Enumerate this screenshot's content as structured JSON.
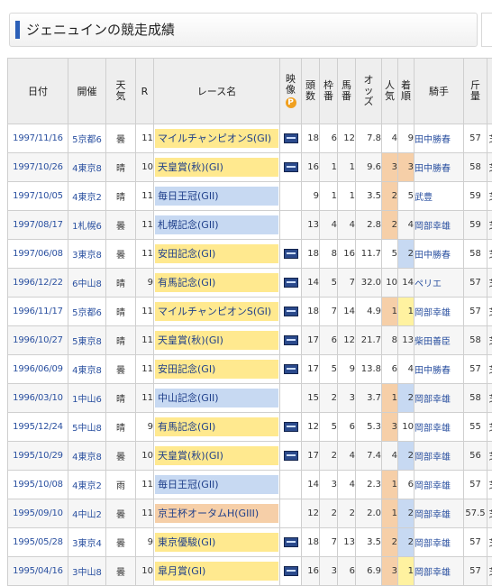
{
  "page": {
    "title": "ジェニュインの競走成績"
  },
  "colors": {
    "accent": "#2b5fb8",
    "g1": "#ffe98f",
    "g2": "#c7d9f2",
    "g3": "#f6cfa8"
  },
  "columns": {
    "date": "日付",
    "course": "開催",
    "weather": "天気",
    "race_no": "R",
    "race_name": "レース名",
    "video": "映像",
    "video_badge": "P",
    "runners": "頭数",
    "gate": "枠番",
    "horse_no": "馬番",
    "odds": "オッズ",
    "popularity": "人気",
    "finish": "着順",
    "jockey": "騎手",
    "weight": "斤量",
    "extra": ""
  },
  "rows": [
    {
      "date": "1997/11/16",
      "course": "5京都6",
      "weather": "曇",
      "race_no": "11",
      "race_name": "マイルチャンピオンS(GI)",
      "grade": "g1",
      "video": true,
      "runners": "18",
      "gate": "6",
      "horse_no": "12",
      "odds": "7.8",
      "popularity": "4",
      "finish": "9",
      "jockey": "田中勝春",
      "weight": "57",
      "extra": "芝"
    },
    {
      "date": "1997/10/26",
      "course": "4東京8",
      "weather": "晴",
      "race_no": "10",
      "race_name": "天皇賞(秋)(GI)",
      "grade": "g1",
      "video": true,
      "runners": "16",
      "gate": "1",
      "horse_no": "1",
      "odds": "9.6",
      "popularity": "3",
      "finish": "3",
      "jockey": "田中勝春",
      "weight": "58",
      "extra": "芝"
    },
    {
      "date": "1997/10/05",
      "course": "4東京2",
      "weather": "晴",
      "race_no": "11",
      "race_name": "毎日王冠(GII)",
      "grade": "g2",
      "video": false,
      "runners": "9",
      "gate": "1",
      "horse_no": "1",
      "odds": "3.5",
      "popularity": "2",
      "finish": "5",
      "jockey": "武豊",
      "weight": "59",
      "extra": "芝"
    },
    {
      "date": "1997/08/17",
      "course": "1札幌6",
      "weather": "曇",
      "race_no": "11",
      "race_name": "札幌記念(GII)",
      "grade": "g2",
      "video": false,
      "runners": "13",
      "gate": "4",
      "horse_no": "4",
      "odds": "2.8",
      "popularity": "2",
      "finish": "4",
      "jockey": "岡部幸雄",
      "weight": "59",
      "extra": "芝"
    },
    {
      "date": "1997/06/08",
      "course": "3東京8",
      "weather": "曇",
      "race_no": "11",
      "race_name": "安田記念(GI)",
      "grade": "g1",
      "video": true,
      "runners": "18",
      "gate": "8",
      "horse_no": "16",
      "odds": "11.7",
      "popularity": "5",
      "finish": "2",
      "jockey": "田中勝春",
      "weight": "58",
      "extra": "芝"
    },
    {
      "date": "1996/12/22",
      "course": "6中山8",
      "weather": "晴",
      "race_no": "9",
      "race_name": "有馬記念(GI)",
      "grade": "g1",
      "video": true,
      "runners": "14",
      "gate": "5",
      "horse_no": "7",
      "odds": "32.0",
      "popularity": "10",
      "finish": "14",
      "jockey": "ペリエ",
      "weight": "57",
      "extra": "芝"
    },
    {
      "date": "1996/11/17",
      "course": "5京都6",
      "weather": "晴",
      "race_no": "11",
      "race_name": "マイルチャンピオンS(GI)",
      "grade": "g1",
      "video": true,
      "runners": "18",
      "gate": "7",
      "horse_no": "14",
      "odds": "4.9",
      "popularity": "1",
      "finish": "1",
      "jockey": "岡部幸雄",
      "weight": "57",
      "extra": "芝"
    },
    {
      "date": "1996/10/27",
      "course": "5東京8",
      "weather": "晴",
      "race_no": "11",
      "race_name": "天皇賞(秋)(GI)",
      "grade": "g1",
      "video": true,
      "runners": "17",
      "gate": "6",
      "horse_no": "12",
      "odds": "21.7",
      "popularity": "8",
      "finish": "13",
      "jockey": "柴田善臣",
      "weight": "58",
      "extra": "芝"
    },
    {
      "date": "1996/06/09",
      "course": "4東京8",
      "weather": "曇",
      "race_no": "11",
      "race_name": "安田記念(GI)",
      "grade": "g1",
      "video": true,
      "runners": "17",
      "gate": "5",
      "horse_no": "9",
      "odds": "13.8",
      "popularity": "6",
      "finish": "4",
      "jockey": "田中勝春",
      "weight": "57",
      "extra": "芝"
    },
    {
      "date": "1996/03/10",
      "course": "1中山6",
      "weather": "晴",
      "race_no": "11",
      "race_name": "中山記念(GII)",
      "grade": "g2",
      "video": false,
      "runners": "15",
      "gate": "2",
      "horse_no": "3",
      "odds": "3.7",
      "popularity": "1",
      "finish": "2",
      "jockey": "岡部幸雄",
      "weight": "58",
      "extra": "芝"
    },
    {
      "date": "1995/12/24",
      "course": "5中山8",
      "weather": "晴",
      "race_no": "9",
      "race_name": "有馬記念(GI)",
      "grade": "g1",
      "video": true,
      "runners": "12",
      "gate": "5",
      "horse_no": "6",
      "odds": "5.3",
      "popularity": "3",
      "finish": "10",
      "jockey": "岡部幸雄",
      "weight": "55",
      "extra": "芝"
    },
    {
      "date": "1995/10/29",
      "course": "4東京8",
      "weather": "曇",
      "race_no": "10",
      "race_name": "天皇賞(秋)(GI)",
      "grade": "g1",
      "video": true,
      "runners": "17",
      "gate": "2",
      "horse_no": "4",
      "odds": "7.4",
      "popularity": "4",
      "finish": "2",
      "jockey": "岡部幸雄",
      "weight": "56",
      "extra": "芝"
    },
    {
      "date": "1995/10/08",
      "course": "4東京2",
      "weather": "雨",
      "race_no": "11",
      "race_name": "毎日王冠(GII)",
      "grade": "g2",
      "video": false,
      "runners": "14",
      "gate": "3",
      "horse_no": "4",
      "odds": "2.3",
      "popularity": "1",
      "finish": "6",
      "jockey": "岡部幸雄",
      "weight": "57",
      "extra": "芝"
    },
    {
      "date": "1995/09/10",
      "course": "4中山2",
      "weather": "曇",
      "race_no": "11",
      "race_name": "京王杯オータムH(GIII)",
      "grade": "g3",
      "video": false,
      "runners": "12",
      "gate": "2",
      "horse_no": "2",
      "odds": "2.0",
      "popularity": "1",
      "finish": "2",
      "jockey": "岡部幸雄",
      "weight": "57.5",
      "extra": "芝"
    },
    {
      "date": "1995/05/28",
      "course": "3東京4",
      "weather": "曇",
      "race_no": "9",
      "race_name": "東京優駿(GI)",
      "grade": "g1",
      "video": true,
      "runners": "18",
      "gate": "7",
      "horse_no": "13",
      "odds": "3.5",
      "popularity": "2",
      "finish": "2",
      "jockey": "岡部幸雄",
      "weight": "57",
      "extra": "芝"
    },
    {
      "date": "1995/04/16",
      "course": "3中山8",
      "weather": "曇",
      "race_no": "10",
      "race_name": "皐月賞(GI)",
      "grade": "g1",
      "video": true,
      "runners": "16",
      "gate": "3",
      "horse_no": "6",
      "odds": "6.9",
      "popularity": "3",
      "finish": "1",
      "jockey": "岡部幸雄",
      "weight": "57",
      "extra": "芝"
    }
  ]
}
